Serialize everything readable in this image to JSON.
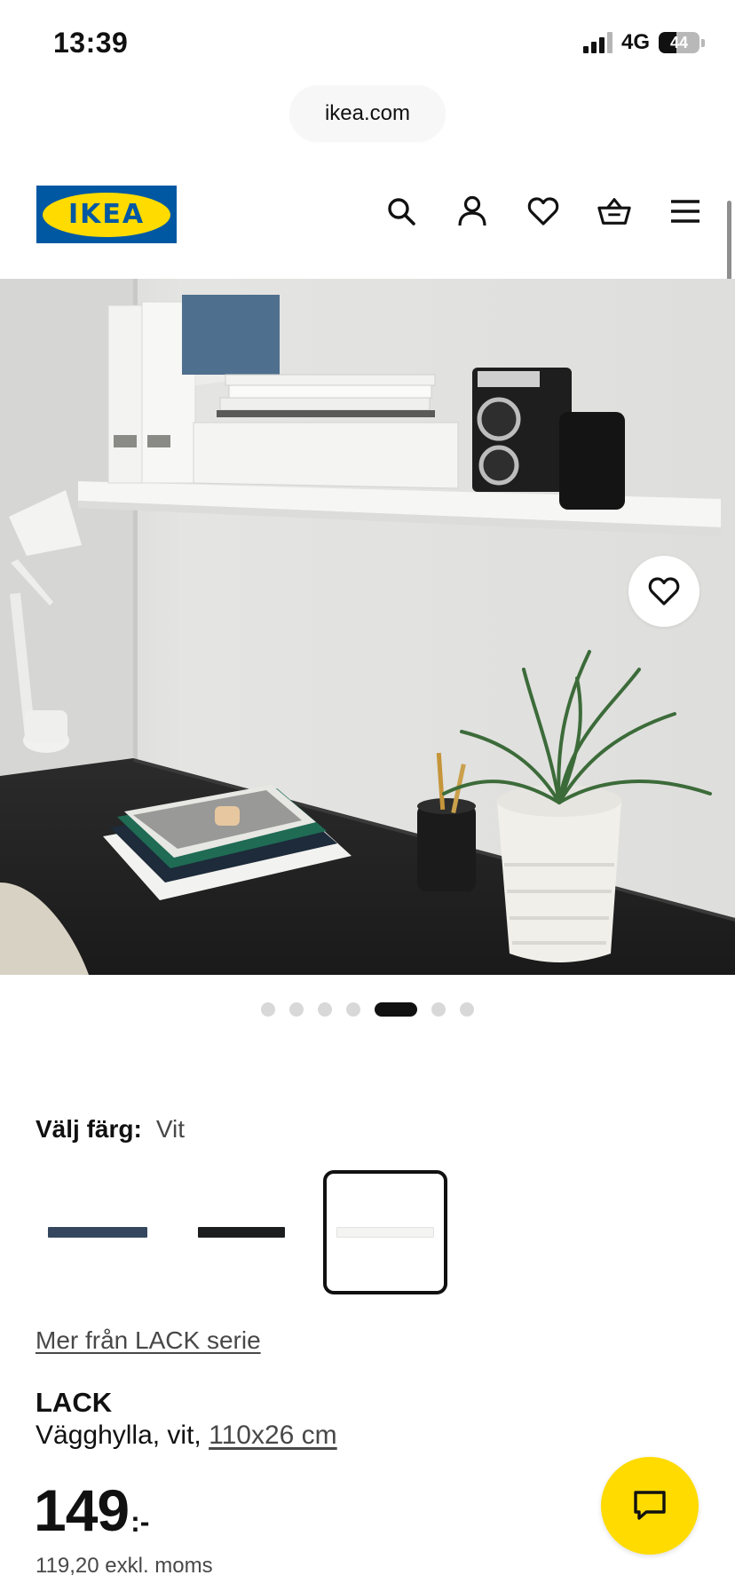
{
  "status_bar": {
    "time": "13:39",
    "network": "4G",
    "battery": "44",
    "battery_level": 0.44
  },
  "browser": {
    "url": "ikea.com"
  },
  "header": {
    "logo_text": "IKEA",
    "icons": [
      "search-icon",
      "account-icon",
      "favorites-icon",
      "cart-icon",
      "menu-icon"
    ]
  },
  "gallery": {
    "image_count": 7,
    "active_index": 4,
    "favorite_icon": "heart-outline-icon"
  },
  "color_picker": {
    "label": "Välj färg:",
    "selected": "Vit",
    "swatches": [
      {
        "color": "#34475f",
        "selected": false
      },
      {
        "color": "#1c1d1f",
        "selected": false
      },
      {
        "color": "#f4f4f2",
        "selected": true
      }
    ]
  },
  "series_link": "Mer från LACK serie",
  "product": {
    "name": "LACK",
    "description": "Vägghylla, vit,",
    "size": "110x26 cm",
    "price": "149",
    "price_suffix": ":-",
    "price_ex_vat": "119,20 exkl. moms"
  },
  "chat": {
    "icon": "chat-icon"
  },
  "colors": {
    "ikea_blue": "#0058a3",
    "ikea_yellow": "#ffdb00",
    "text": "#111111",
    "muted": "#484848"
  }
}
